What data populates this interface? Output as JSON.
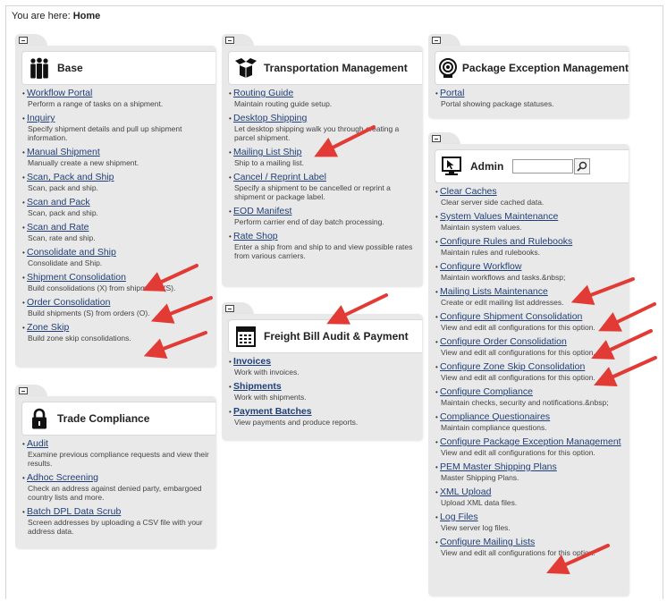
{
  "breadcrumb": {
    "prefix": "You are here:",
    "current": "Home"
  },
  "panels": {
    "base": {
      "title": "Base",
      "items": [
        {
          "name": "Workflow Portal",
          "desc": "Perform a range of tasks on a shipment."
        },
        {
          "name": "Inquiry",
          "desc": "Specify shipment details and pull up shipment information."
        },
        {
          "name": "Manual Shipment",
          "desc": "Manually create a new shipment."
        },
        {
          "name": "Scan, Pack and Ship",
          "desc": "Scan, pack and ship."
        },
        {
          "name": "Scan and Pack",
          "desc": "Scan, pack and ship."
        },
        {
          "name": "Scan and Rate",
          "desc": "Scan, rate and ship."
        },
        {
          "name": "Consolidate and Ship",
          "desc": "Consolidate and Ship."
        },
        {
          "name": "Shipment Consolidation",
          "desc": "Build consolidations (X) from shipments (S)."
        },
        {
          "name": "Order Consolidation",
          "desc": "Build shipments (S) from orders (O)."
        },
        {
          "name": "Zone Skip",
          "desc": "Build zone skip consolidations."
        }
      ]
    },
    "trade": {
      "title": "Trade Compliance",
      "items": [
        {
          "name": "Audit",
          "desc": "Examine previous compliance requests and view their results."
        },
        {
          "name": "Adhoc Screening",
          "desc": "Check an address against denied party, embargoed country lists and more."
        },
        {
          "name": "Batch DPL Data Scrub",
          "desc": "Screen addresses by uploading a CSV file with your address data."
        }
      ]
    },
    "transport": {
      "title": "Transportation Management",
      "items": [
        {
          "name": "Routing Guide",
          "desc": "Maintain routing guide setup."
        },
        {
          "name": "Desktop Shipping",
          "desc": "Let desktop shipping walk you through creating a parcel shipment."
        },
        {
          "name": "Mailing List Ship",
          "desc": "Ship to a mailing list."
        },
        {
          "name": "Cancel / Reprint Label",
          "desc": "Specify a shipment to be cancelled or reprint a shipment or package label."
        },
        {
          "name": "EOD Manifest",
          "desc": "Perform carrier end of day batch processing."
        },
        {
          "name": "Rate Shop",
          "desc": "Enter a ship from and ship to and view possible rates from various carriers."
        }
      ]
    },
    "freight": {
      "title": "Freight Bill Audit & Payment",
      "items": [
        {
          "name": "Invoices",
          "desc": "Work with invoices."
        },
        {
          "name": "Shipments",
          "desc": "Work with shipments."
        },
        {
          "name": "Payment Batches",
          "desc": "View payments and produce reports."
        }
      ]
    },
    "pem": {
      "title": "Package Exception Management",
      "items": [
        {
          "name": "Portal",
          "desc": "Portal showing package statuses."
        }
      ]
    },
    "admin": {
      "title": "Admin",
      "search_value": "",
      "items": [
        {
          "name": "Clear Caches",
          "desc": "Clear server side cached data."
        },
        {
          "name": "System Values Maintenance",
          "desc": "Maintain system values."
        },
        {
          "name": "Configure Rules and Rulebooks",
          "desc": "Maintain rules and rulebooks."
        },
        {
          "name": "Configure Workflow",
          "desc": "Maintain workflows and tasks.&nbsp;"
        },
        {
          "name": "Mailing Lists Maintenance",
          "desc": "Create or edit mailing list addresses."
        },
        {
          "name": "Configure Shipment Consolidation",
          "desc": "View and edit all configurations for this option."
        },
        {
          "name": "Configure Order Consolidation",
          "desc": "View and edit all configurations for this option."
        },
        {
          "name": "Configure Zone Skip Consolidation",
          "desc": "View and edit all configurations for this option."
        },
        {
          "name": "Configure Compliance",
          "desc": "Maintain checks, security and notifications.&nbsp;"
        },
        {
          "name": "Compliance Questionaires",
          "desc": "Maintain compliance questions."
        },
        {
          "name": "Configure Package Exception Management",
          "desc": "View and edit all configurations for this option."
        },
        {
          "name": "PEM Master Shipping Plans",
          "desc": "Master Shipping Plans."
        },
        {
          "name": "XML Upload",
          "desc": "Upload XML data files."
        },
        {
          "name": "Log Files",
          "desc": "View server log files."
        },
        {
          "name": "Configure Mailing Lists",
          "desc": "View and edit all configurations for this option."
        }
      ]
    }
  },
  "colors": {
    "link": "#1f3f7a",
    "panel_bg": "#e9e9e9",
    "annotation_arrow": "#e23a34"
  }
}
